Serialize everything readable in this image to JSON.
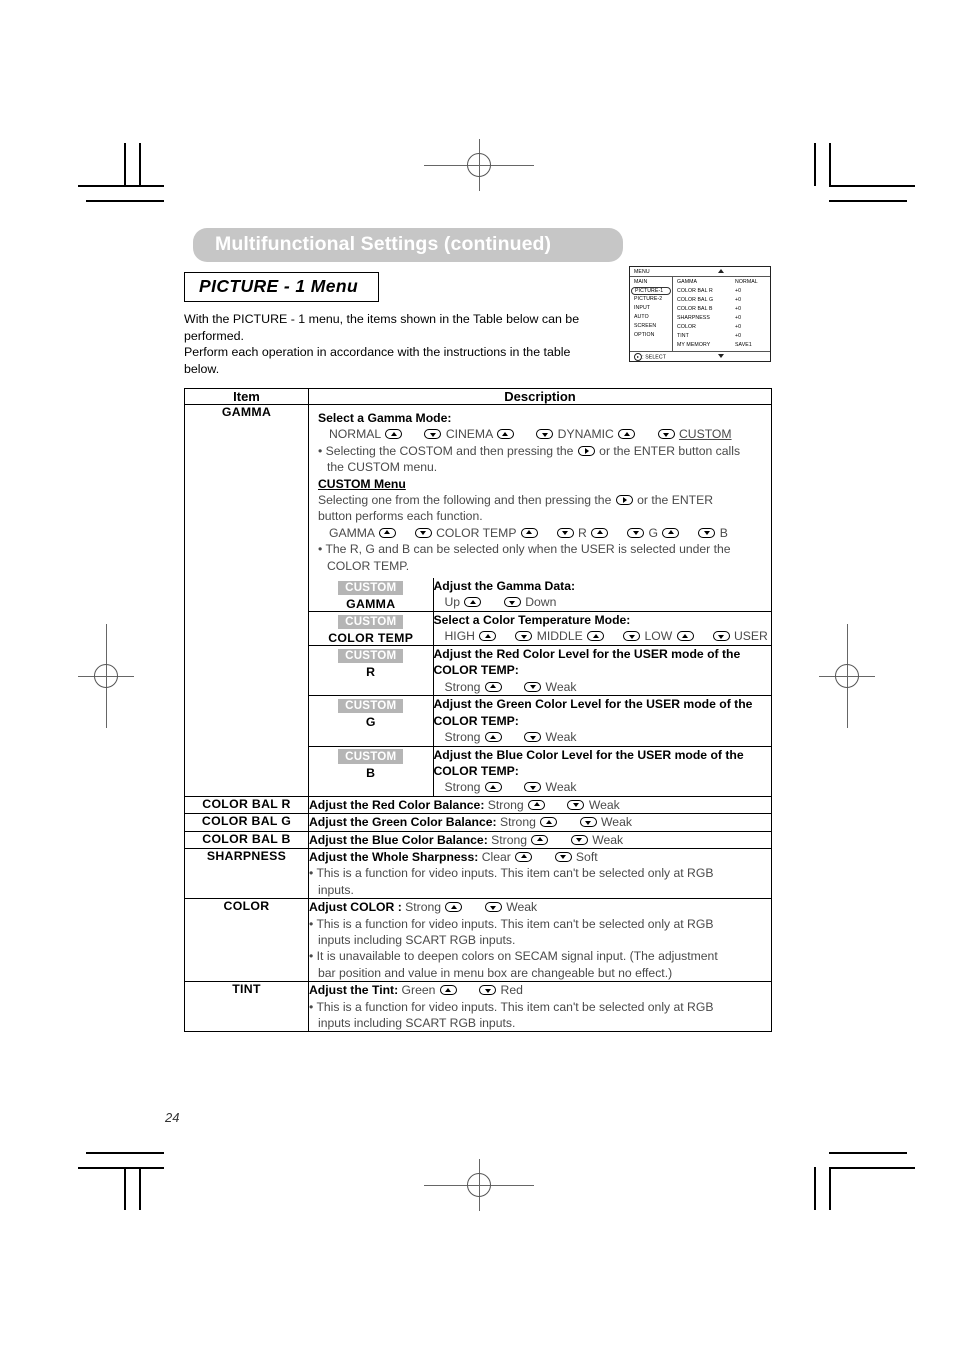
{
  "page": {
    "number": "24",
    "header_title": "Multifunctional Settings (continued)",
    "section_title": "PICTURE - 1 Menu",
    "intro_line1": "With the PICTURE - 1 menu, the items shown in the Table below can be performed.",
    "intro_line2": "Perform each operation in accordance with the instructions in the table below."
  },
  "osd": {
    "top_left": "MENU",
    "top_center_icon": "triangle-up-icon",
    "bottom_left": "SELECT",
    "bottom_left_icon": "right-arrow-key-icon",
    "bottom_center_icon": "triangle-down-icon",
    "left_items": [
      "MAIN",
      "PICTURE-1",
      "PICTURE-2",
      "INPUT",
      "AUTO",
      "SCREEN",
      "OPTION"
    ],
    "selected_left_item": "PICTURE-1",
    "rows": [
      {
        "name": "GAMMA",
        "value": "NORMAL"
      },
      {
        "name": "COLOR BAL R",
        "value": "+0"
      },
      {
        "name": "COLOR BAL G",
        "value": "+0"
      },
      {
        "name": "COLOR BAL B",
        "value": "+0"
      },
      {
        "name": "SHARPNESS",
        "value": "+0"
      },
      {
        "name": "COLOR",
        "value": "+0"
      },
      {
        "name": "TINT",
        "value": "+0"
      },
      {
        "name": "MY MEMORY",
        "value": "SAVE1"
      }
    ]
  },
  "table": {
    "header": {
      "item": "Item",
      "description": "Description"
    },
    "gamma": {
      "item_label": "GAMMA",
      "heading": "Select a Gamma Mode:",
      "mode_seq": {
        "a": "NORMAL",
        "b": "CINEMA",
        "c": "DYNAMIC",
        "d": "CUSTOM"
      },
      "note1_a": "Selecting the COSTOM and then pressing the",
      "note1_b": "or the ENTER button calls",
      "note1_c": "the CUSTOM menu.",
      "custom_menu_heading": "CUSTOM Menu",
      "custom_menu_text_a": "Selecting one from the following and then pressing the",
      "custom_menu_text_b": "or the ENTER",
      "custom_menu_text_c": "button performs each function.",
      "custom_seq": {
        "a": "GAMMA",
        "b": "COLOR TEMP",
        "c": "R",
        "d": "G",
        "e": "B"
      },
      "note2_a": "The R, G and B can be selected only when the USER is selected under the",
      "note2_b": "COLOR TEMP.",
      "subrows": [
        {
          "badge": "CUSTOM",
          "name": "GAMMA",
          "heading": "Adjust the Gamma Data:",
          "left": "Up",
          "right": "Down"
        },
        {
          "badge": "CUSTOM",
          "name": "COLOR TEMP",
          "heading": "Select a Color Temperature Mode:",
          "seq": {
            "a": "HIGH",
            "b": "MIDDLE",
            "c": "LOW",
            "d": "USER"
          }
        },
        {
          "badge": "CUSTOM",
          "name": "R",
          "heading_line1": "Adjust the Red Color Level for the USER mode of the",
          "heading_line2": "COLOR TEMP:",
          "left": "Strong",
          "right": "Weak"
        },
        {
          "badge": "CUSTOM",
          "name": "G",
          "heading_line1": "Adjust the Green Color Level for the USER mode of the",
          "heading_line2": "COLOR TEMP:",
          "left": "Strong",
          "right": "Weak"
        },
        {
          "badge": "CUSTOM",
          "name": "B",
          "heading_line1": "Adjust the Blue Color Level for the USER mode of the",
          "heading_line2": "COLOR TEMP:",
          "left": "Strong",
          "right": "Weak"
        }
      ]
    },
    "color_bal_r": {
      "item_label": "COLOR BAL R",
      "heading": "Adjust the Red Color Balance:",
      "left": "Strong",
      "right": "Weak"
    },
    "color_bal_g": {
      "item_label": "COLOR BAL G",
      "heading": "Adjust the Green Color Balance:",
      "left": "Strong",
      "right": "Weak"
    },
    "color_bal_b": {
      "item_label": "COLOR BAL B",
      "heading": "Adjust the Blue Color Balance:",
      "left": "Strong",
      "right": "Weak"
    },
    "sharpness": {
      "item_label": "SHARPNESS",
      "heading": "Adjust the Whole Sharpness:",
      "left": "Clear",
      "right": "Soft",
      "note_a": "This is a function for video inputs. This item can't be selected only at RGB",
      "note_b": "inputs."
    },
    "color": {
      "item_label": "COLOR",
      "heading": "Adjust COLOR :",
      "left": "Strong",
      "right": "Weak",
      "note1_a": "This is a function for video inputs. This item can't be selected only at  RGB",
      "note1_b": "inputs including SCART RGB inputs.",
      "note2_a": "It is unavailable to deepen colors on SECAM signal input. (The adjustment",
      "note2_b": "bar position and value in menu box are changeable but no effect.)"
    },
    "tint": {
      "item_label": "TINT",
      "heading": "Adjust the Tint:",
      "left": "Green",
      "right": "Red",
      "note_a": "This is a function for video inputs. This item can't be selected only at  RGB",
      "note_b": "inputs including SCART RGB inputs."
    }
  }
}
